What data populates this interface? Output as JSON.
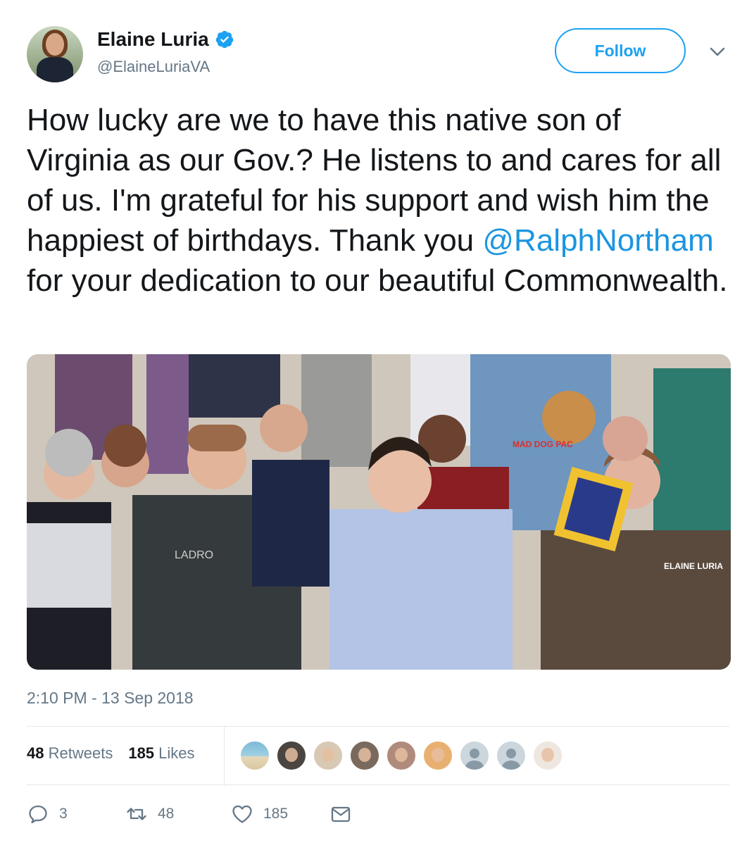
{
  "author": {
    "display_name": "Elaine Luria",
    "handle": "@ElaineLuriaVA",
    "verified": true
  },
  "follow_button_label": "Follow",
  "tweet": {
    "text_before_mention": "How lucky are we to have this native son of Virginia as our Gov.? He listens to and cares for all of us. I'm grateful for his support and wish him the happiest of birthdays. Thank you ",
    "mention": "@RalphNortham",
    "text_after_mention": " for your dedication to our beautiful Commonwealth."
  },
  "media": {
    "sign_texts": [
      "LADRO",
      "MAD DOG PAC",
      "ELAINE LURIA"
    ]
  },
  "timestamp": "2:10 PM - 13 Sep 2018",
  "stats": {
    "retweets_count": "48",
    "retweets_label": "Retweets",
    "likes_count": "185",
    "likes_label": "Likes"
  },
  "likers": [
    {
      "icon": "beach-photo",
      "bg": "#6fa8c8"
    },
    {
      "icon": "dark-photo",
      "bg": "#4a4540"
    },
    {
      "icon": "woman-photo",
      "bg": "#d8c9b5"
    },
    {
      "icon": "man-photo",
      "bg": "#7a6a5e"
    },
    {
      "icon": "group-photo",
      "bg": "#b08a7c"
    },
    {
      "icon": "blonde-photo",
      "bg": "#e8b070"
    },
    {
      "icon": "default-avatar",
      "bg": "#ccd6dd"
    },
    {
      "icon": "default-avatar",
      "bg": "#ccd6dd"
    },
    {
      "icon": "sketch-photo",
      "bg": "#eee7e0"
    }
  ],
  "actions": {
    "reply_count": "3",
    "retweet_count": "48",
    "like_count": "185"
  },
  "colors": {
    "accent": "#1da1f2",
    "mention": "#1b95e0",
    "muted": "#657786",
    "border": "#e1e8ed"
  }
}
